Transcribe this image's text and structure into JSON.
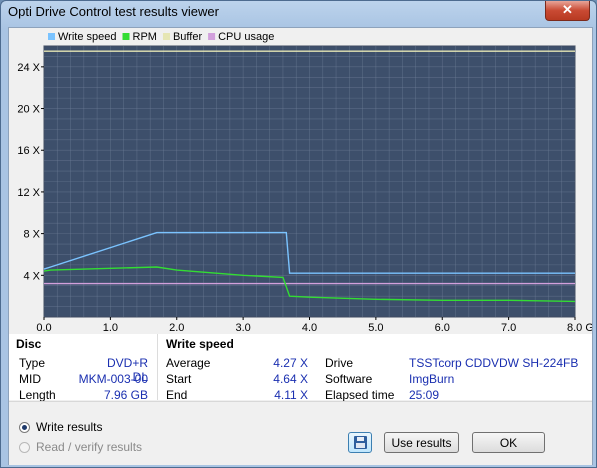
{
  "window": {
    "title": "Opti Drive Control test results viewer",
    "close_label": "✕"
  },
  "chart": {
    "legend": [
      {
        "label": "Write speed",
        "color": "#7ac3ff"
      },
      {
        "label": "RPM",
        "color": "#33dd33"
      },
      {
        "label": "Buffer",
        "color": "#e6e6b4"
      },
      {
        "label": "CPU usage",
        "color": "#d2a0dc"
      }
    ],
    "y_ticks": [
      "24 X",
      "20 X",
      "16 X",
      "12 X",
      "8 X",
      "4 X"
    ],
    "x_ticks": [
      "0.0",
      "1.0",
      "2.0",
      "3.0",
      "4.0",
      "5.0",
      "6.0",
      "7.0",
      "8.0 GB"
    ],
    "colors": {
      "plot_bg": "#3d4f6b",
      "grid": "#6f7f98",
      "write": "#7ac3ff",
      "rpm": "#33dd33",
      "buffer": "#e6e6b4",
      "cpu": "#d2a0dc"
    }
  },
  "chart_data": {
    "type": "line",
    "xlabel": "",
    "ylabel": "",
    "xlim": [
      0,
      8.0
    ],
    "ylim": [
      0,
      26
    ],
    "series": [
      {
        "name": "Write speed",
        "x": [
          0,
          0.1,
          1.7,
          1.8,
          2.4,
          3.65,
          3.7,
          3.8,
          4.0,
          8.0
        ],
        "values": [
          4.6,
          4.8,
          8.1,
          8.1,
          8.1,
          8.1,
          4.2,
          4.2,
          4.2,
          4.2
        ]
      },
      {
        "name": "RPM",
        "x": [
          0,
          0.1,
          1.7,
          2.0,
          3.0,
          3.6,
          3.7,
          4.0,
          5.0,
          6.0,
          7.0,
          8.0
        ],
        "values": [
          4.4,
          4.5,
          4.8,
          4.5,
          4.0,
          3.8,
          2.0,
          1.9,
          1.7,
          1.6,
          1.6,
          1.5
        ]
      },
      {
        "name": "Buffer",
        "x": [
          0,
          8.0
        ],
        "values": [
          25.5,
          25.5
        ]
      },
      {
        "name": "CPU usage",
        "x": [
          0,
          8.0
        ],
        "values": [
          3.2,
          3.2
        ]
      }
    ]
  },
  "disc": {
    "header": "Disc",
    "rows": [
      {
        "label": "Type",
        "value": "DVD+R DL"
      },
      {
        "label": "MID",
        "value": "MKM-003-00"
      },
      {
        "label": "Length",
        "value": "7.96 GB"
      }
    ]
  },
  "write_speed": {
    "header": "Write speed",
    "rows": [
      {
        "label": "Average",
        "value": "4.27 X"
      },
      {
        "label": "Start",
        "value": "4.64 X"
      },
      {
        "label": "End",
        "value": "4.11 X"
      }
    ]
  },
  "drive_info": {
    "rows": [
      {
        "label": "Drive",
        "value": "TSSTcorp  CDDVDW SH-224FB"
      },
      {
        "label": "Software",
        "value": "ImgBurn"
      },
      {
        "label": "Elapsed time",
        "value": "25:09"
      }
    ]
  },
  "options": {
    "write_results": "Write results",
    "read_verify_results": "Read / verify results"
  },
  "buttons": {
    "use_results": "Use results",
    "ok": "OK"
  }
}
